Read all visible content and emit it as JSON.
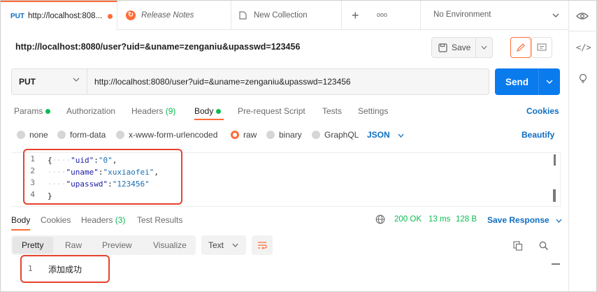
{
  "tabs": [
    {
      "method": "PUT",
      "label": "http://localhost:808..."
    },
    {
      "label": "Release Notes"
    },
    {
      "label": "New Collection"
    }
  ],
  "tab_add": "+",
  "tab_more": "ooo",
  "environment": "No Environment",
  "request_title": "http://localhost:8080/user?uid=&uname=zenganiu&upasswd=123456",
  "save_label": "Save",
  "method": "PUT",
  "url": "http://localhost:8080/user?uid=&uname=zenganiu&upasswd=123456",
  "send_label": "Send",
  "request_tabs": {
    "params": "Params",
    "authorization": "Authorization",
    "headers": "Headers",
    "headers_count": "(9)",
    "body": "Body",
    "prerequest": "Pre-request Script",
    "tests": "Tests",
    "settings": "Settings",
    "cookies": "Cookies"
  },
  "body_types": {
    "none": "none",
    "form_data": "form-data",
    "urlencoded": "x-www-form-urlencoded",
    "raw": "raw",
    "binary": "binary",
    "graphql": "GraphQL",
    "format": "JSON",
    "beautify": "Beautify"
  },
  "code": {
    "line_numbers": [
      "1",
      "2",
      "3",
      "4"
    ],
    "open_brace": "{",
    "close_brace": "}",
    "fields": [
      {
        "key": "\"uid\"",
        "value": "\"0\"",
        "suffix": ","
      },
      {
        "key": "\"uname\"",
        "value": "\"xuxiaofei\"",
        "suffix": ","
      },
      {
        "key": "\"upasswd\"",
        "value": "\"123456\"",
        "suffix": ""
      }
    ]
  },
  "response": {
    "tabs": {
      "body": "Body",
      "cookies": "Cookies",
      "headers": "Headers",
      "headers_count": "(3)",
      "test_results": "Test Results"
    },
    "status": "200 OK",
    "time": "13 ms",
    "size": "128 B",
    "save_response": "Save Response",
    "views": {
      "pretty": "Pretty",
      "raw": "Raw",
      "preview": "Preview",
      "visualize": "Visualize"
    },
    "format": "Text",
    "line_number": "1",
    "body_text": "添加成功"
  },
  "colors": {
    "accent": "#ff6c37",
    "send": "#097bed",
    "success": "#0cbb52",
    "link": "#0f6ec2",
    "highlight_box": "#e5432f"
  }
}
